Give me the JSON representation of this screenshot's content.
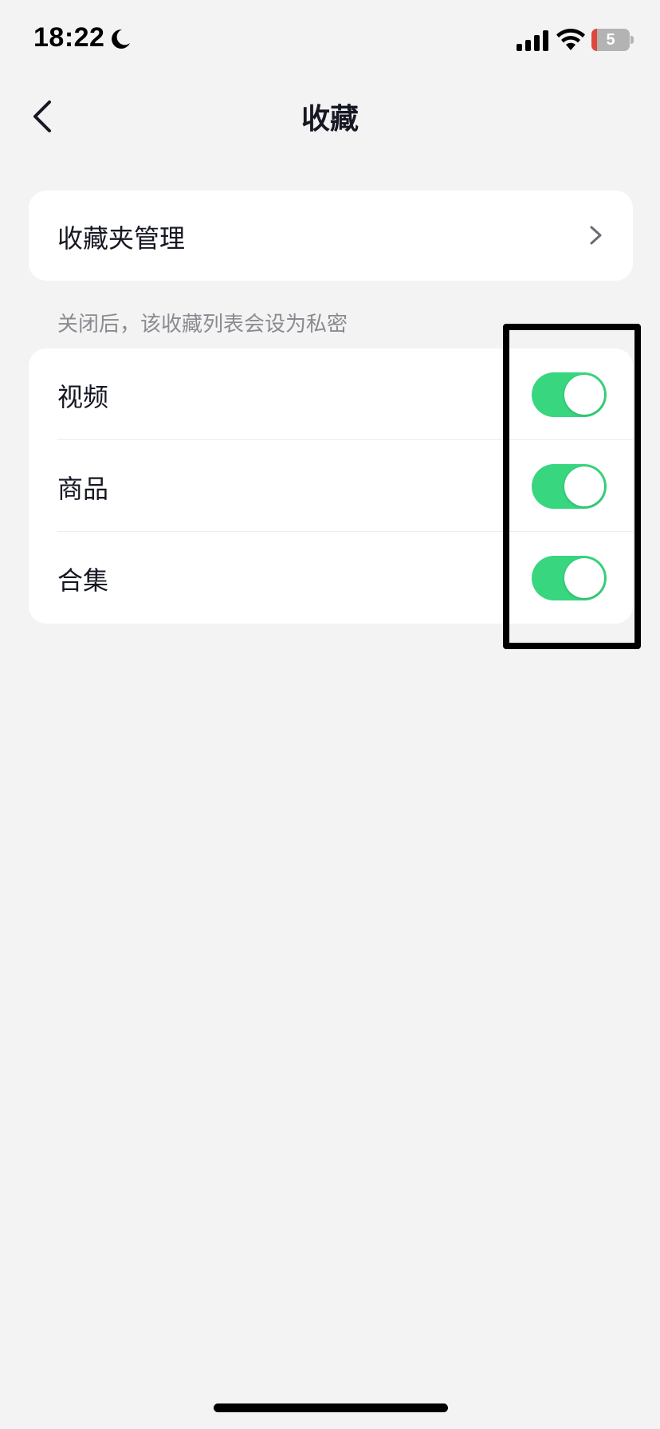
{
  "status_bar": {
    "time": "18:22",
    "battery_level": "5",
    "icons": [
      "moon-icon",
      "signal-icon",
      "wifi-icon",
      "battery-charging-icon"
    ]
  },
  "header": {
    "title": "收藏",
    "back_icon": "chevron-left-icon"
  },
  "manage": {
    "label": "收藏夹管理",
    "icon": "chevron-right-icon"
  },
  "privacy": {
    "hint": "关闭后，该收藏列表会设为私密",
    "items": [
      {
        "label": "视频",
        "enabled": true
      },
      {
        "label": "商品",
        "enabled": true
      },
      {
        "label": "合集",
        "enabled": true
      }
    ]
  },
  "colors": {
    "background": "#f3f3f3",
    "card": "#ffffff",
    "switch_on": "#37d67f",
    "hint_text": "#8a8b91",
    "highlight_border": "#000000"
  }
}
